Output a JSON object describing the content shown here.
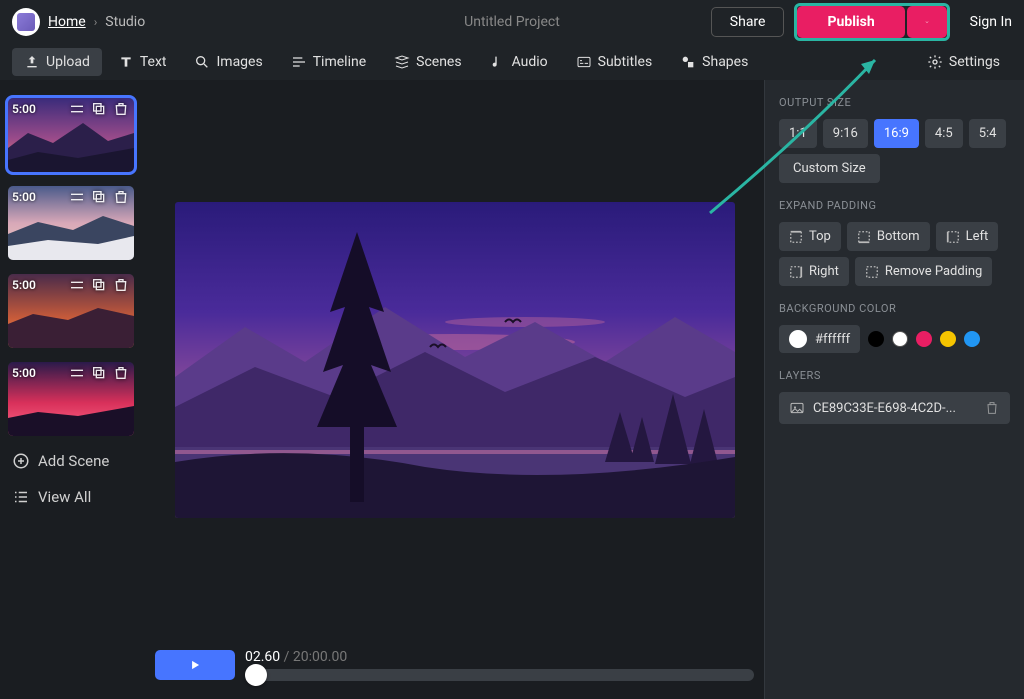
{
  "header": {
    "home": "Home",
    "studio": "Studio",
    "project_title": "Untitled Project",
    "share": "Share",
    "publish": "Publish",
    "sign_in": "Sign In"
  },
  "toolbar": {
    "upload": "Upload",
    "text": "Text",
    "images": "Images",
    "timeline": "Timeline",
    "scenes": "Scenes",
    "audio": "Audio",
    "subtitles": "Subtitles",
    "shapes": "Shapes",
    "settings": "Settings"
  },
  "scenes": {
    "items": [
      {
        "duration": "5:00"
      },
      {
        "duration": "5:00"
      },
      {
        "duration": "5:00"
      },
      {
        "duration": "5:00"
      }
    ],
    "add_scene": "Add Scene",
    "view_all": "View All"
  },
  "playback": {
    "current": "02.60",
    "separator": " / ",
    "duration": "20:00.00"
  },
  "right": {
    "output_size": {
      "title": "OUTPUT SIZE",
      "ratios": [
        "1:1",
        "9:16",
        "16:9",
        "4:5",
        "5:4"
      ],
      "selected": "16:9",
      "custom": "Custom Size"
    },
    "expand_padding": {
      "title": "EXPAND PADDING",
      "top": "Top",
      "bottom": "Bottom",
      "left": "Left",
      "right": "Right",
      "remove": "Remove Padding"
    },
    "background_color": {
      "title": "BACKGROUND COLOR",
      "value": "#ffffff",
      "swatches": [
        "#000000",
        "#ffffff",
        "#e91e63",
        "#f5c400",
        "#2196f3"
      ]
    },
    "layers": {
      "title": "LAYERS",
      "items": [
        "CE89C33E-E698-4C2D-..."
      ]
    }
  }
}
